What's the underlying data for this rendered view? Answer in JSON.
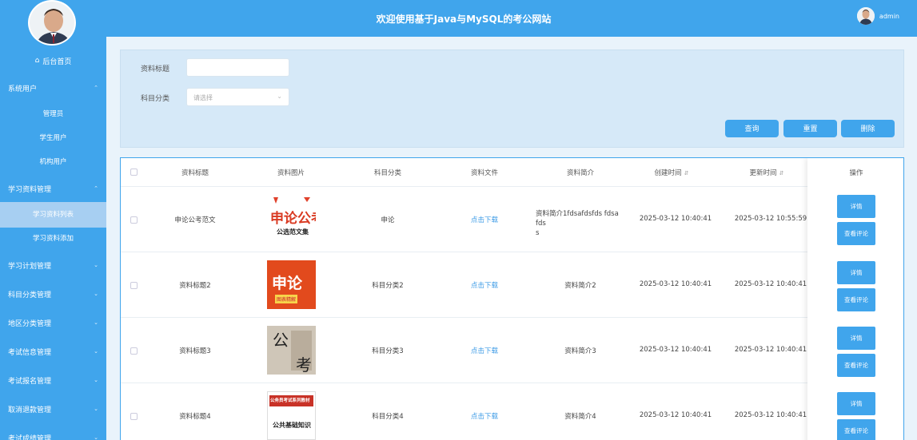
{
  "header": {
    "title": "欢迎使用基于Java与MySQL的考公网站",
    "username": "admin"
  },
  "sidebar": {
    "home_label": "后台首页",
    "groups": [
      {
        "label": "系统用户",
        "expanded": true,
        "items": [
          "管理员",
          "学生用户",
          "机构用户"
        ]
      },
      {
        "label": "学习资料管理",
        "expanded": true,
        "items": [
          "学习资料列表",
          "学习资料添加"
        ]
      },
      {
        "label": "学习计划管理"
      },
      {
        "label": "科目分类管理"
      },
      {
        "label": "地区分类管理"
      },
      {
        "label": "考试信息管理"
      },
      {
        "label": "考试报名管理"
      },
      {
        "label": "取消退款管理"
      },
      {
        "label": "考试成绩管理"
      }
    ]
  },
  "search": {
    "title_label": "资料标题",
    "title_value": "",
    "subject_label": "科目分类",
    "subject_placeholder": "请选择",
    "query_button": "查询",
    "reset_button": "重置",
    "delete_button": "删除"
  },
  "table": {
    "columns": [
      "资料标题",
      "资料图片",
      "科目分类",
      "资料文件",
      "资料简介",
      "创建时间",
      "更新时间",
      "操作"
    ],
    "detail_label": "详情",
    "comment_label": "查看评论",
    "rows": [
      {
        "title": "申论公考范文",
        "subject": "申论",
        "file": "点击下载",
        "intro": "资料简介1fdsafdsfds fdsa fds",
        "intro2": "s",
        "created": "2025-03-12 10:40:41",
        "updated": "2025-03-12 10:55:59",
        "img_text": "申论公考",
        "img_sub": "公选范文集"
      },
      {
        "title": "资料标题2",
        "subject": "科目分类2",
        "file": "点击下载",
        "intro": "资料简介2",
        "created": "2025-03-12 10:40:41",
        "updated": "2025-03-12 10:40:41",
        "img_text": "申论",
        "img_sub": "图表精解"
      },
      {
        "title": "资料标题3",
        "subject": "科目分类3",
        "file": "点击下载",
        "intro": "资料简介3",
        "created": "2025-03-12 10:40:41",
        "updated": "2025-03-12 10:40:41",
        "img_text": "公",
        "img_sub": "考"
      },
      {
        "title": "资料标题4",
        "subject": "科目分类4",
        "file": "点击下载",
        "intro": "资料简介4",
        "created": "2025-03-12 10:40:41",
        "updated": "2025-03-12 10:40:41",
        "img_text": "公务员考试系列教材",
        "img_sub": "公共基础知识"
      }
    ]
  },
  "colors": {
    "primary": "#40a5ec",
    "panel": "#d6e9f8",
    "active_item": "#a7cff2"
  }
}
